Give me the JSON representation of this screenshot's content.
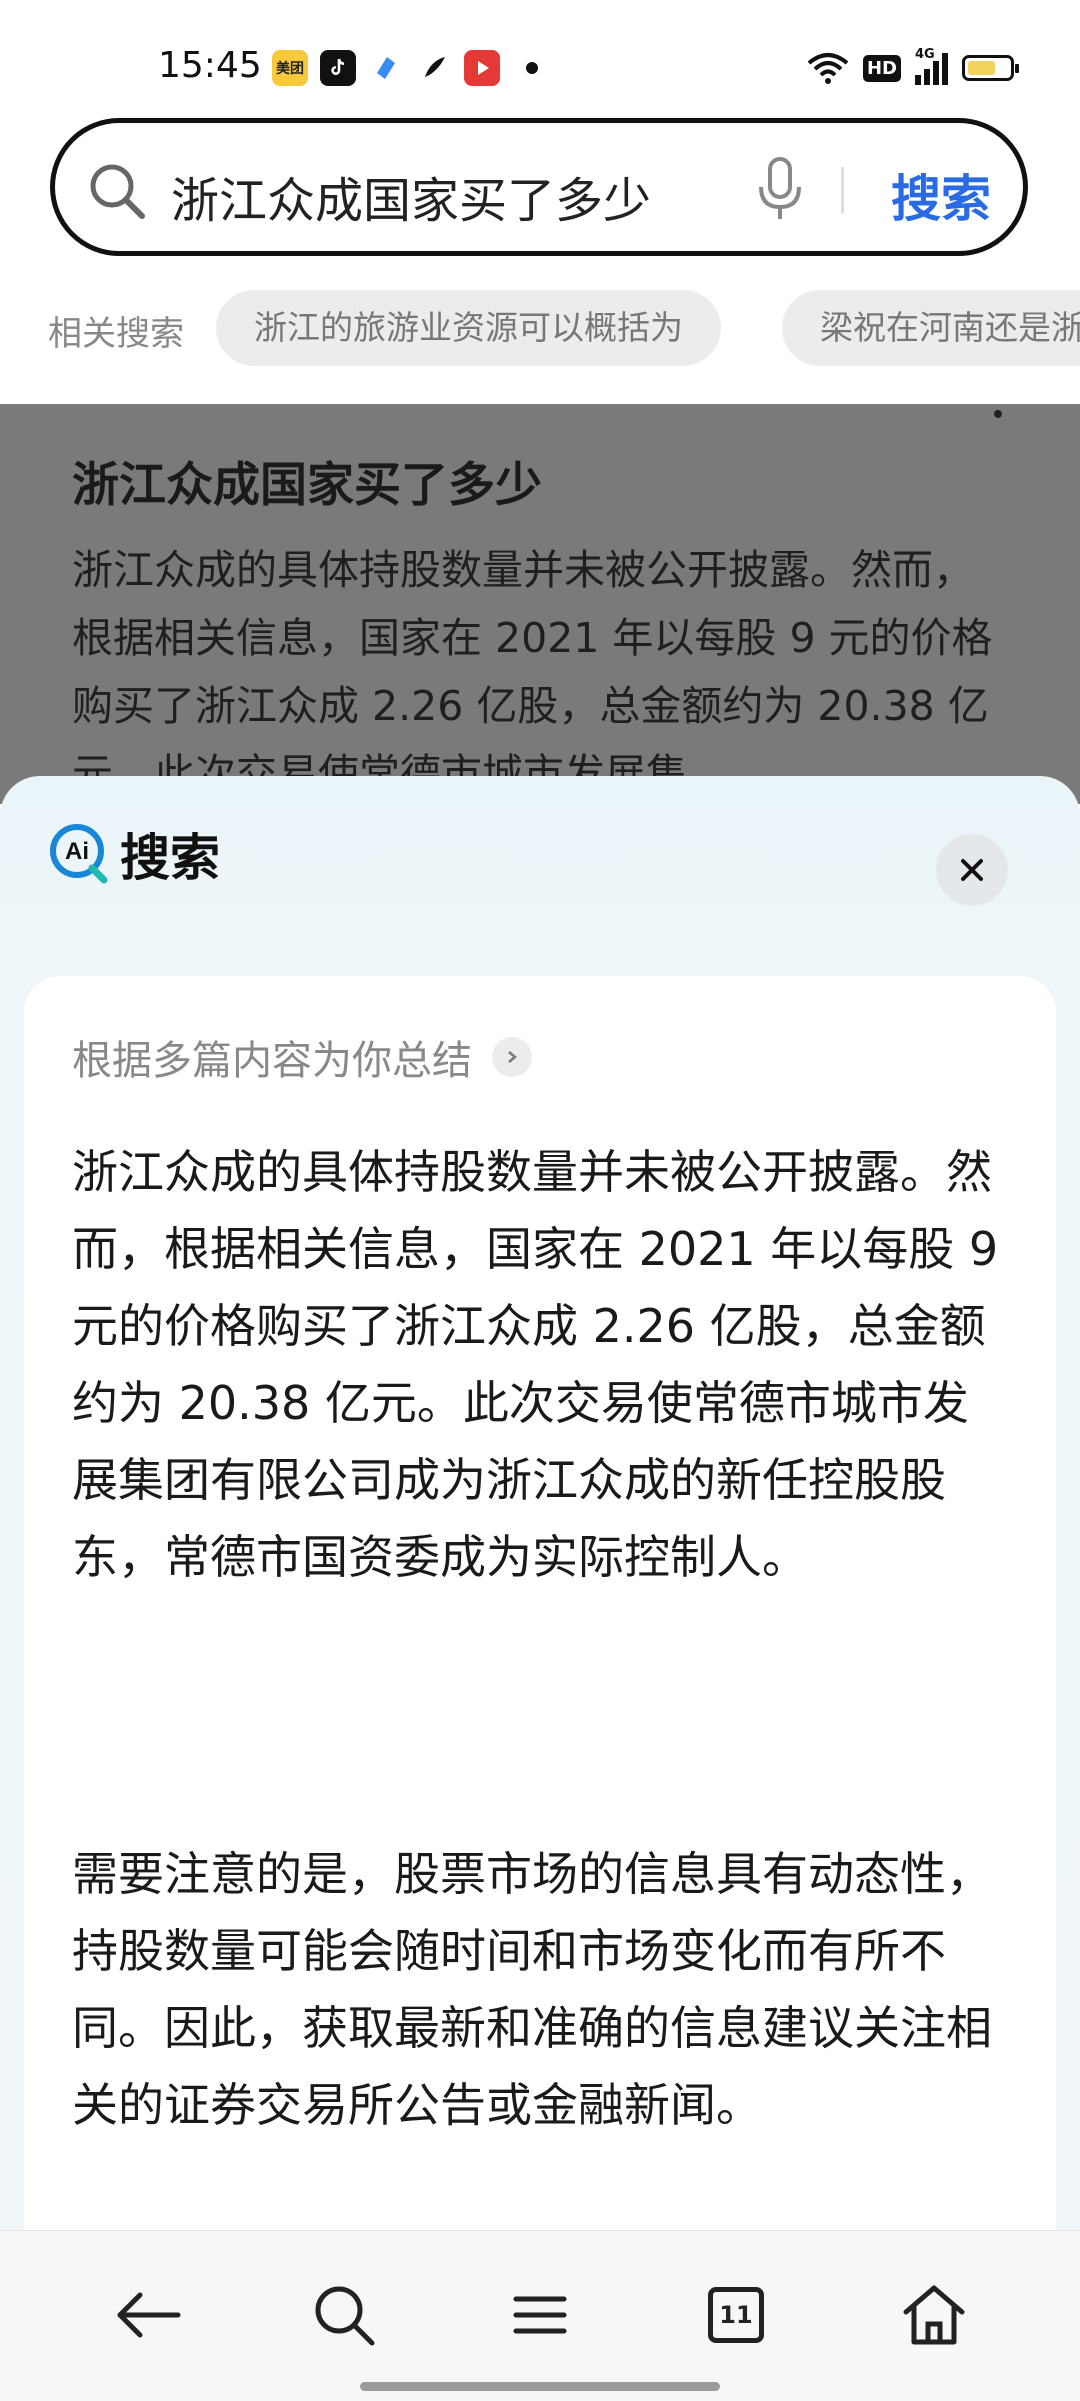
{
  "status_bar": {
    "time": "15:45",
    "notification_icons": [
      "meituan-icon",
      "tiktok-icon",
      "app-icon",
      "feather-app-icon",
      "video-app-icon"
    ],
    "meituan_label": "美团",
    "system_icons": [
      "wifi-icon",
      "hd-icon",
      "4g-signal-icon",
      "battery-icon"
    ],
    "hd_label": "HD",
    "network_label": "4G"
  },
  "search": {
    "query": "浙江众成国家买了多少",
    "button_label": "搜索"
  },
  "related": {
    "label": "相关搜索",
    "chips": [
      "浙江的旅游业资源可以概括为",
      "梁祝在河南还是浙"
    ]
  },
  "background_result": {
    "title": "浙江众成国家买了多少",
    "body": "浙江众成的具体持股数量并未被公开披露。然而，根据相关信息，国家在 2021 年以每股 9 元的价格购买了浙江众成 2.26 亿股，总金额约为 20.38 亿元，此次交易使常德市城市发展集"
  },
  "ai_sheet": {
    "title": "搜索",
    "logo_text": "Ai",
    "summary_label": "根据多篇内容为你总结",
    "paragraph_1": "浙江众成的具体持股数量并未被公开披露。然而，根据相关信息，国家在 2021 年以每股 9 元的价格购买了浙江众成 2.26 亿股，总金额约为 20.38 亿元。此次交易使常德市城市发展集团有限公司成为浙江众成的新任控股股东，常德市国资委成为实际控制人。",
    "paragraph_2": "需要注意的是，股票市场的信息具有动态性，持股数量可能会随时间和市场变化而有所不同。因此，获取最新和准确的信息建议关注相关的证券交易所公告或金融新闻。"
  },
  "bottom_nav": {
    "items": [
      "back-icon",
      "search-icon",
      "menu-icon",
      "tabs-icon",
      "home-icon"
    ],
    "tab_count": "11"
  },
  "colors": {
    "accent": "#2a6be3",
    "ai_blue": "#1a86d8",
    "ai_teal": "#21b8b0"
  }
}
